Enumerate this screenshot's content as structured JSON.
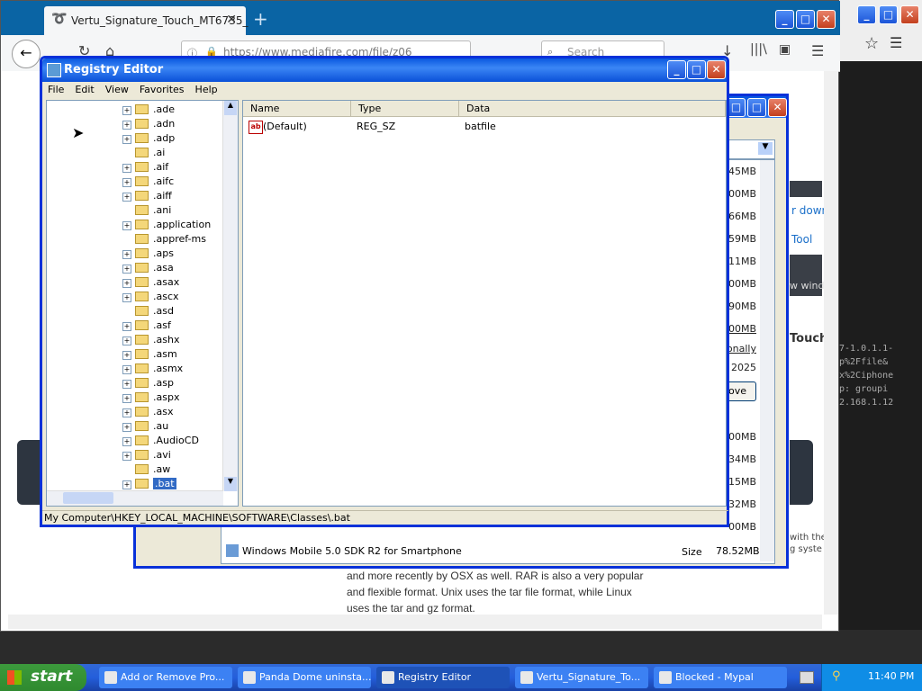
{
  "browser": {
    "tab_title": "Vertu_Signature_Touch_MT6735_",
    "tab_close": "✕",
    "new_tab": "+",
    "url": "https://www.mediafire.com/file/z06",
    "search_placeholder": "Search",
    "back": "←",
    "menu": "☰"
  },
  "web": {
    "paragraph": "and more recently by OSX as well. RAR is also a very popular and flexible format. Unix uses the tar file format, while Linux uses the tar and gz format.",
    "side_link1": "r down",
    "side_link2": "Tool",
    "side_text1": "w windo",
    "side_heading1": "Touch",
    "side_heading2": "h",
    "side_small1": "with the",
    "side_small2": "g syste",
    "code_lines": [
      "7-1.0.1.1-",
      "p%2Ffile&",
      "x%2Ciphone",
      "p: groupi",
      "2.168.1.12"
    ]
  },
  "add_remove": {
    "sizes": [
      "45MB",
      "00MB",
      "66MB",
      "59MB",
      "11MB",
      "00MB",
      "90MB",
      "00MB",
      "onally",
      "2025",
      "00MB",
      "34MB",
      "15MB",
      "32MB",
      "00MB"
    ],
    "remove_button": "ove",
    "program_name": "Windows Mobile 5.0 SDK R2 for Smartphone",
    "size_label": "Size",
    "size_value": "78.52MB"
  },
  "regedit": {
    "title": "Registry Editor",
    "menu": [
      "File",
      "Edit",
      "View",
      "Favorites",
      "Help"
    ],
    "tree": [
      ".ade",
      ".adn",
      ".adp",
      ".ai",
      ".aif",
      ".aifc",
      ".aiff",
      ".ani",
      ".application",
      ".appref-ms",
      ".aps",
      ".asa",
      ".asax",
      ".ascx",
      ".asd",
      ".asf",
      ".ashx",
      ".asm",
      ".asmx",
      ".asp",
      ".aspx",
      ".asx",
      ".au",
      ".AudioCD",
      ".avi",
      ".aw",
      ".bat"
    ],
    "tree_expandable": [
      true,
      true,
      true,
      false,
      true,
      true,
      true,
      false,
      true,
      false,
      true,
      true,
      true,
      true,
      false,
      true,
      true,
      true,
      true,
      true,
      true,
      true,
      true,
      true,
      true,
      false,
      true
    ],
    "selected": ".bat",
    "columns": [
      "Name",
      "Type",
      "Data"
    ],
    "rows": [
      {
        "name": "(Default)",
        "type": "REG_SZ",
        "data": "batfile"
      }
    ],
    "status": "My Computer\\HKEY_LOCAL_MACHINE\\SOFTWARE\\Classes\\.bat"
  },
  "taskbar": {
    "start": "start",
    "tasks": [
      "Add or Remove Pro...",
      "Panda Dome uninsta...",
      "Registry Editor",
      "Vertu_Signature_To...",
      "Blocked - Mypal"
    ],
    "active": "Registry Editor",
    "clock": "11:40 PM"
  }
}
